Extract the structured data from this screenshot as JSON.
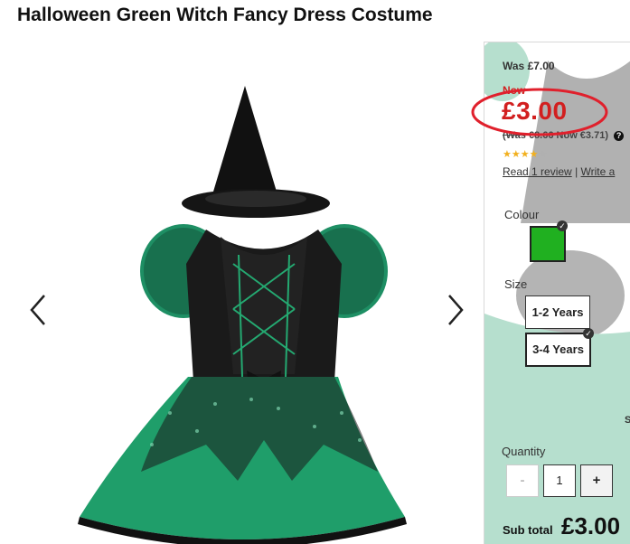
{
  "product": {
    "title": "Halloween Green Witch Fancy Dress Costume"
  },
  "gallery": {
    "prev_icon": "chevron-left-icon",
    "next_icon": "chevron-right-icon"
  },
  "pricing": {
    "was": "Was £7.00",
    "now_label": "Now",
    "price": "£3.00",
    "euro_prefix": "(Was €8.66",
    "euro_now": "Now €3.71)",
    "help_icon": "?",
    "annotation_color": "#e0202c"
  },
  "reviews": {
    "rating": 4,
    "max": 5,
    "read_link": "Read 1 review",
    "separator": "|",
    "write_link": "Write a"
  },
  "colour": {
    "label": "Colour",
    "selected_hex": "#20b020"
  },
  "size": {
    "label": "Size",
    "options": [
      "1-2 Years",
      "3-4 Years"
    ],
    "selected": "3-4 Years"
  },
  "quantity": {
    "label": "Quantity",
    "minus": "-",
    "value": "1",
    "plus": "+"
  },
  "subtotal": {
    "label": "Sub total",
    "value": "£3.00"
  },
  "partial_text": "S",
  "colors": {
    "price_red": "#d21f1f",
    "dress_green": "#1f9e6a",
    "dress_black": "#1a1a1a"
  }
}
